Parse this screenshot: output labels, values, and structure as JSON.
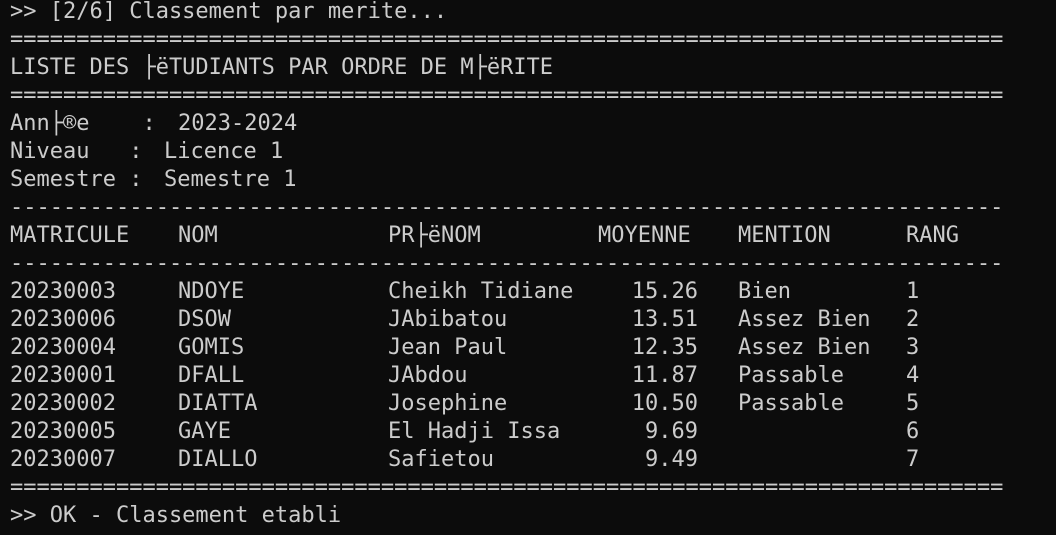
{
  "terminal": {
    "step_line": ">> [2/6] Classement par merite...",
    "rule_double": "================================================================================",
    "rule_single": "--------------------------------------------------------------------------------",
    "title": "LISTE DES ├ëTUDIANTS PAR ORDRE DE M├ëRITE",
    "meta": [
      {
        "label": "Ann├®e    :",
        "value": "2023-2024"
      },
      {
        "label": "Niveau   :",
        "value": "Licence 1"
      },
      {
        "label": "Semestre :",
        "value": "Semestre 1"
      }
    ],
    "headers": {
      "matricule": "MATRICULE",
      "nom": "NOM",
      "prenom": "PR├ëNOM",
      "moyenne": "MOYENNE",
      "mention": "MENTION",
      "rang": "RANG"
    },
    "rows": [
      {
        "matricule": "20230003",
        "nom": "NDOYE",
        "prenom": "Cheikh Tidiane",
        "moyenne": "15.26",
        "mention": "Bien",
        "rang": "1"
      },
      {
        "matricule": "20230006",
        "nom": "DSOW",
        "prenom": "JAbibatou",
        "moyenne": "13.51",
        "mention": "Assez Bien",
        "rang": "2"
      },
      {
        "matricule": "20230004",
        "nom": "GOMIS",
        "prenom": "Jean Paul",
        "moyenne": "12.35",
        "mention": "Assez Bien",
        "rang": "3"
      },
      {
        "matricule": "20230001",
        "nom": "DFALL",
        "prenom": "JAbdou",
        "moyenne": "11.87",
        "mention": "Passable",
        "rang": "4"
      },
      {
        "matricule": "20230002",
        "nom": "DIATTA",
        "prenom": "Josephine",
        "moyenne": "10.50",
        "mention": "Passable",
        "rang": "5"
      },
      {
        "matricule": "20230005",
        "nom": "GAYE",
        "prenom": "El Hadji Issa",
        "moyenne": "9.69",
        "mention": "",
        "rang": "6"
      },
      {
        "matricule": "20230007",
        "nom": "DIALLO",
        "prenom": "Safietou",
        "moyenne": "9.49",
        "mention": "",
        "rang": "7"
      }
    ],
    "done_line": ">> OK - Classement etabli"
  }
}
